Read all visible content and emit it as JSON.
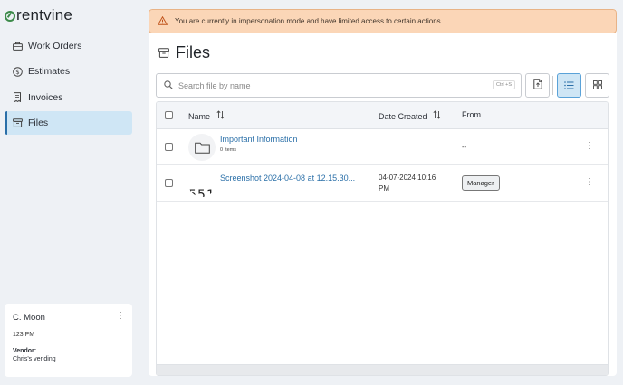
{
  "brand": {
    "name": "rentvine"
  },
  "sidebar": {
    "items": [
      {
        "label": "Work Orders",
        "icon": "briefcase-icon"
      },
      {
        "label": "Estimates",
        "icon": "dollar-icon"
      },
      {
        "label": "Invoices",
        "icon": "receipt-icon"
      },
      {
        "label": "Files",
        "icon": "box-icon",
        "active": true
      }
    ],
    "user": {
      "name": "C. Moon",
      "address": "123 PM",
      "vendor_label": "Vendor:",
      "vendor_name": "Chris's vending"
    }
  },
  "banner": {
    "text": "You are currently in impersonation mode and have limited access to certain actions",
    "color": "#fbd6b7"
  },
  "page": {
    "title": "Files"
  },
  "search": {
    "placeholder": "Search file by name",
    "shortcut": "Ctrl +S"
  },
  "table": {
    "columns": {
      "name": "Name",
      "date": "Date Created",
      "from": "From"
    },
    "rows": [
      {
        "type": "folder",
        "name": "Important Information",
        "count": "0 Items",
        "date": "",
        "from": "--"
      },
      {
        "type": "file",
        "name": "Screenshot 2024-04-08 at 12.15.30...",
        "thumb_text": "551",
        "date_line1": "04-07-2024 10:16",
        "date_line2": "PM",
        "from_badge": "Manager"
      }
    ]
  },
  "colors": {
    "accent": "#2a6fa8",
    "active_bg": "#cfe6f5"
  }
}
